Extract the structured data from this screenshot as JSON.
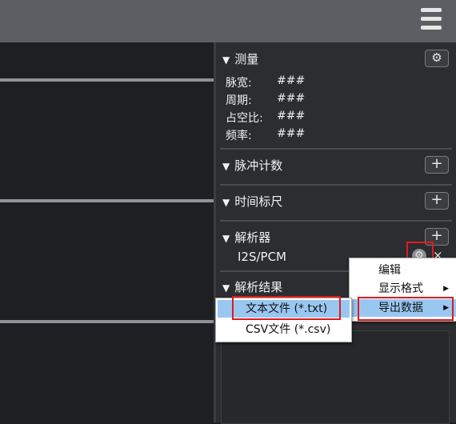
{
  "toolbar": {
    "menu_icon": "hamburger-menu-icon"
  },
  "measurement": {
    "title": "测量",
    "settings_icon": "gear-icon",
    "rows": [
      {
        "label": "脉宽:",
        "value": "###"
      },
      {
        "label": "周期:",
        "value": "###"
      },
      {
        "label": "占空比:",
        "value": "###"
      },
      {
        "label": "频率:",
        "value": "###"
      }
    ]
  },
  "pulse_counter": {
    "title": "脉冲计数",
    "add_label": "+"
  },
  "time_ruler": {
    "title": "时间标尺",
    "add_label": "+"
  },
  "decoder": {
    "title": "解析器",
    "add_label": "+",
    "item_label": "I2S/PCM",
    "remove_label": "×"
  },
  "decode_results": {
    "title": "解析结果"
  },
  "context_menu": {
    "items": [
      {
        "label": "编辑",
        "has_submenu": false
      },
      {
        "label": "显示格式",
        "has_submenu": true
      },
      {
        "label": "导出数据",
        "has_submenu": true,
        "selected": true
      }
    ]
  },
  "export_submenu": {
    "items": [
      {
        "label": "文本文件 (*.txt)",
        "selected": true
      },
      {
        "label": "CSV文件 (*.csv)",
        "selected": false
      }
    ]
  },
  "colors": {
    "topbar": "#5b5e63",
    "canvas": "#1e1f22",
    "panel": "#2b2d31",
    "highlight": "#9ac7f2",
    "annotation_red": "#e01b1b"
  }
}
